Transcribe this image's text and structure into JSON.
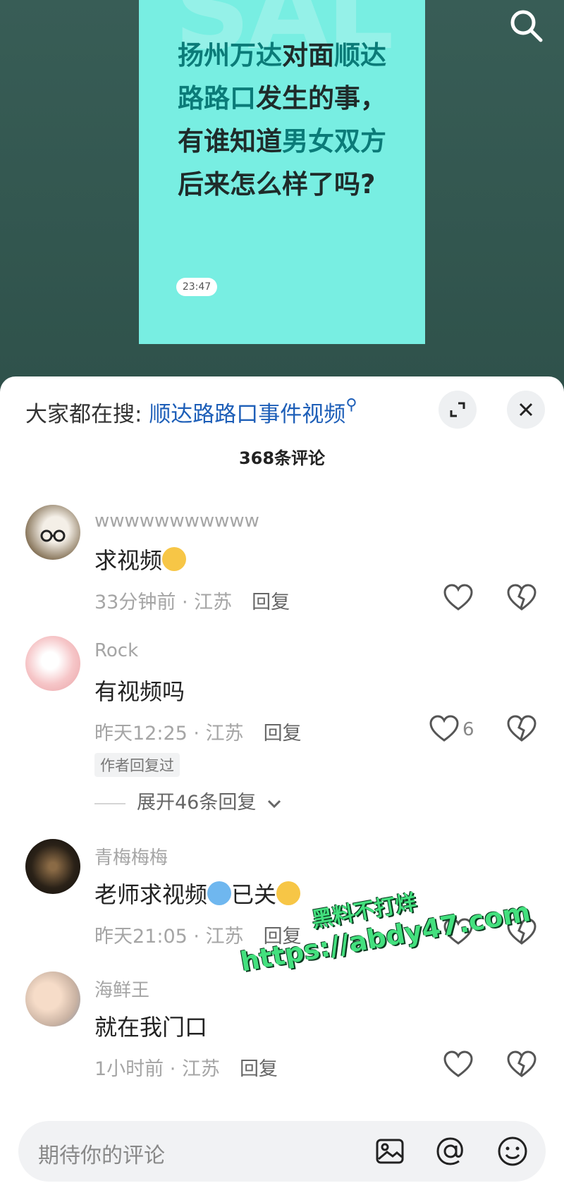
{
  "post": {
    "watermark_letters": "SAL",
    "headline_parts": [
      {
        "text": "扬州万达",
        "hl": true
      },
      {
        "text": "对面",
        "hl": false
      },
      {
        "text": "顺达路路口",
        "hl": true
      },
      {
        "text": "发生的事，有谁知道",
        "hl": false
      },
      {
        "text": "男女双方",
        "hl": true
      },
      {
        "text": "后来怎么样了吗?",
        "hl": false
      }
    ],
    "time": "23:47"
  },
  "sheet": {
    "hot_search_label": "大家都在搜:",
    "hot_search_keyword": "顺达路路口事件视频",
    "comment_count": "368条评论"
  },
  "comments": [
    {
      "user": "wwwwwwwwwww",
      "text": "求视频",
      "emoji": "thinking",
      "time": "33分钟前",
      "region": "江苏",
      "reply": "回复",
      "likes": ""
    },
    {
      "user": "Rock",
      "text": "有视频吗",
      "emoji": "",
      "time": "昨天12:25",
      "region": "江苏",
      "reply": "回复",
      "likes": "6",
      "badge": "作者回复过",
      "expand": "展开46条回复"
    },
    {
      "user": "青梅梅梅",
      "text": "老师求视频",
      "emoji": "crying",
      "text2": "已关",
      "emoji2": "thinking",
      "time": "昨天21:05",
      "region": "江苏",
      "reply": "回复",
      "likes": ""
    },
    {
      "user": "海鲜王",
      "text": "就在我门口",
      "emoji": "",
      "time": "1小时前",
      "region": "江苏",
      "reply": "回复",
      "likes": ""
    }
  ],
  "input": {
    "placeholder": "期待你的评论"
  },
  "overlay": {
    "line1": "黑料不打烊",
    "line2": "https://abdy47.com"
  },
  "icons": [
    "search-icon",
    "expand-icon",
    "close-icon",
    "heart-icon",
    "broken-heart-icon",
    "image-icon",
    "at-icon",
    "emoji-icon",
    "chevron-down-icon"
  ]
}
